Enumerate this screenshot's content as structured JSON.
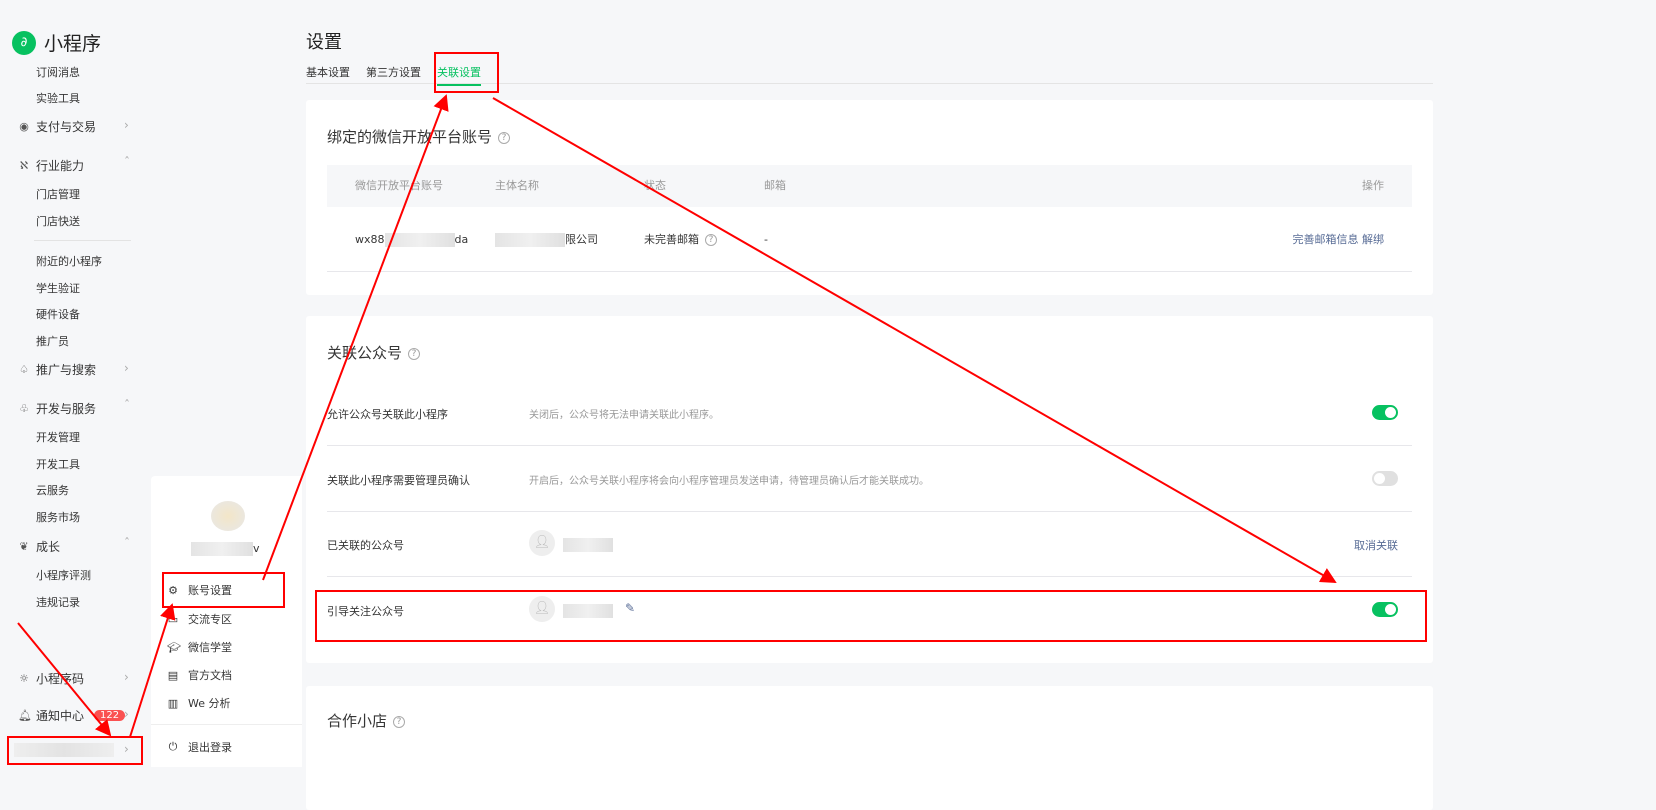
{
  "sidebar": {
    "app_name": "小程序",
    "sub_top": [
      "订阅消息",
      "实验工具"
    ],
    "pay": "支付与交易",
    "industry": "行业能力",
    "industry_items": [
      "门店管理",
      "门店快送",
      "附近的小程序",
      "学生验证",
      "硬件设备",
      "推广员"
    ],
    "promo": "推广与搜索",
    "dev": "开发与服务",
    "dev_items": [
      "开发管理",
      "开发工具",
      "云服务",
      "服务市场"
    ],
    "growth": "成长",
    "growth_items": [
      "小程序评测",
      "违规记录"
    ],
    "qrcode": "小程序码",
    "notify": "通知中心",
    "notify_badge": "122"
  },
  "popup": {
    "username_suffix": "v",
    "items": [
      "账号设置",
      "交流专区",
      "微信学堂",
      "官方文档",
      "We 分析"
    ],
    "logout": "退出登录"
  },
  "header": {
    "title": "设置",
    "tabs": [
      "基本设置",
      "第三方设置",
      "关联设置"
    ],
    "active_tab": 2
  },
  "open_platform": {
    "title": "绑定的微信开放平台账号",
    "columns": [
      "微信开放平台账号",
      "主体名称",
      "状态",
      "邮箱",
      "操作"
    ],
    "row": {
      "account_prefix": "wx88",
      "account_suffix": "da",
      "entity_suffix": "限公司",
      "status": "未完善邮箱",
      "email": "-",
      "actions": [
        "完善邮箱信息",
        "解绑"
      ]
    }
  },
  "official": {
    "title": "关联公众号",
    "rows": [
      {
        "label": "允许公众号关联此小程序",
        "desc": "关闭后，公众号将无法申请关联此小程序。",
        "toggle": true
      },
      {
        "label": "关联此小程序需要管理员确认",
        "desc": "开启后，公众号关联小程序将会向小程序管理员发送申请，待管理员确认后才能关联成功。",
        "toggle": false
      },
      {
        "label": "已关联的公众号",
        "action": "取消关联"
      },
      {
        "label": "引导关注公众号",
        "toggle": true
      }
    ]
  },
  "shop": {
    "title": "合作小店"
  },
  "colors": {
    "accent": "#07c160",
    "link": "#576b95",
    "annotation": "#ff0000"
  }
}
